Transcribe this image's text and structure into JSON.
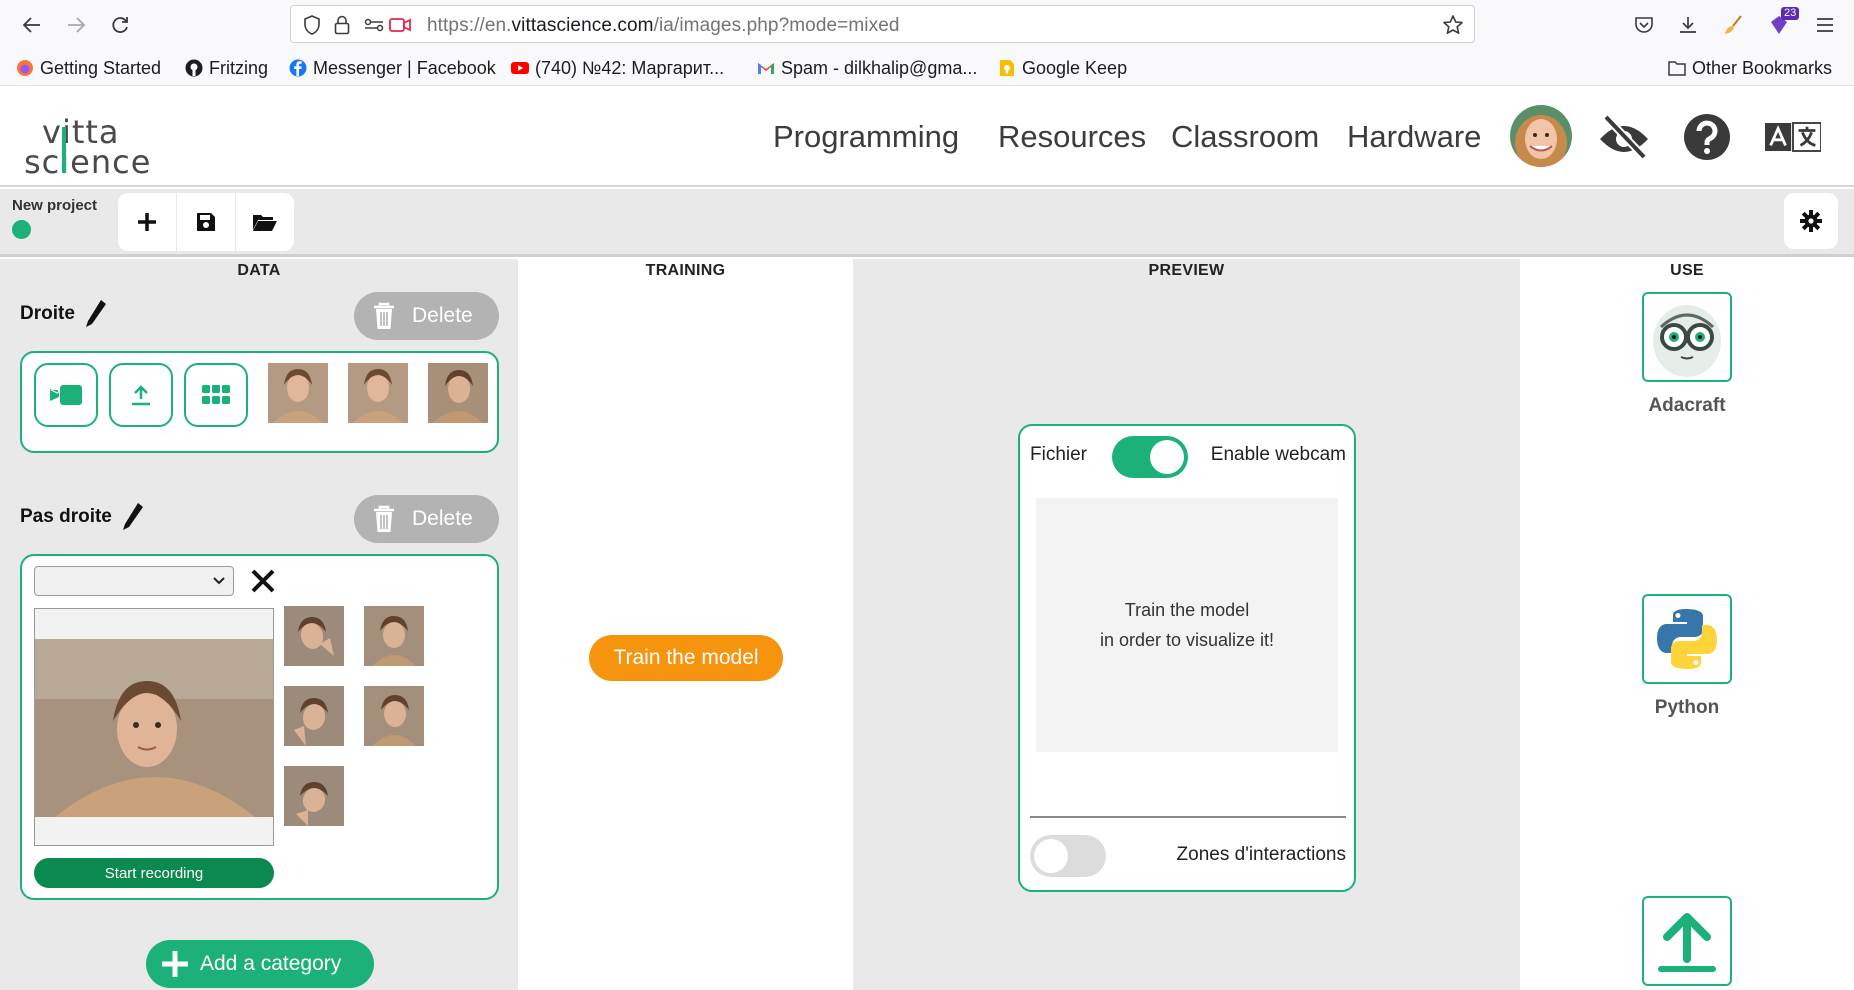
{
  "browser": {
    "url_prefix": "https://en.",
    "url_host": "vittascience.com",
    "url_path": "/ia/images.php?mode=mixed",
    "extension_badge": "23",
    "bookmarks": [
      {
        "label": "Getting Started",
        "icon": "firefox-icon"
      },
      {
        "label": "Fritzing",
        "icon": "github-icon"
      },
      {
        "label": "Messenger | Facebook",
        "icon": "facebook-icon"
      },
      {
        "label": "(740) №42: Маргарит...",
        "icon": "youtube-icon"
      },
      {
        "label": "Spam - dilkhalip@gma...",
        "icon": "gmail-icon"
      },
      {
        "label": "Google Keep",
        "icon": "keep-icon"
      }
    ],
    "other_bookmarks": "Other Bookmarks"
  },
  "header": {
    "logo_top": "vitta",
    "logo_bottom": "science",
    "nav": [
      "Programming",
      "Resources",
      "Classroom",
      "Hardware"
    ]
  },
  "project": {
    "name": "New project",
    "status_color": "#1db17a"
  },
  "columns": {
    "data": "DATA",
    "training": "TRAINING",
    "preview": "PREVIEW",
    "use": "USE"
  },
  "categories": [
    {
      "name": "Droite",
      "delete_label": "Delete",
      "sample_count": 3
    },
    {
      "name": "Pas droite",
      "delete_label": "Delete",
      "sample_count": 5,
      "record_label": "Start recording",
      "webcam_select_value": ""
    }
  ],
  "add_category_label": "Add a category",
  "training": {
    "button_label": "Train the model"
  },
  "preview": {
    "file_label": "Fichier",
    "webcam_label": "Enable webcam",
    "webcam_enabled": true,
    "placeholder_line1": "Train the model",
    "placeholder_line2": "in order to visualize it!",
    "zones_label": "Zones d'interactions",
    "zones_enabled": false
  },
  "use": [
    {
      "label": "Adacraft",
      "icon": "adacraft-icon"
    },
    {
      "label": "Python",
      "icon": "python-icon"
    },
    {
      "label": "",
      "icon": "export-upload-icon"
    }
  ],
  "colors": {
    "accent_green": "#1db17a",
    "record_green": "#0b8a4f",
    "train_orange": "#f7940e",
    "delete_gray": "#b3b3b3"
  }
}
